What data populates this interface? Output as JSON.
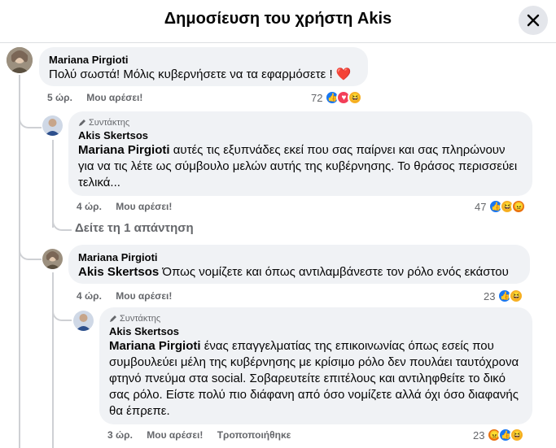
{
  "header": {
    "title": "Δημοσίευση του χρήστη Akis"
  },
  "comments": [
    {
      "author": "Mariana Pirgioti",
      "text": "Πολύ σωστά! Μόλις κυβερνήσετε να τα εφαρμόσετε ! ",
      "heart": "❤️",
      "time": "5 ώρ.",
      "like": "Μου αρέσει!",
      "reactions": "72"
    },
    {
      "badge": "Συντάκτης",
      "author": "Akis Skertsos",
      "mention": "Mariana Pirgioti",
      "text": " αυτές τις εξυπνάδες εκεί που σας παίρνει και σας πληρώνουν για να τις λέτε ως σύμβουλο μελών αυτής της κυβέρνησης. Το θράσος περισσεύει τελικά...",
      "time": "4 ώρ.",
      "like": "Μου αρέσει!",
      "reactions": "47"
    },
    {
      "see_replies": "Δείτε τη 1 απάντηση"
    },
    {
      "author": "Mariana Pirgioti",
      "mention": "Akis Skertsos",
      "text": " Όπως νομίζετε και όπως αντιλαμβάνεστε τον ρόλο ενός εκάστου",
      "time": "4 ώρ.",
      "like": "Μου αρέσει!",
      "reactions": "23"
    },
    {
      "badge": "Συντάκτης",
      "author": "Akis Skertsos",
      "mention": "Mariana Pirgioti",
      "text": " ένας επαγγελματίας της επικοινωνίας όπως εσείς που συμβουλεύει μέλη της κυβέρνησης με κρίσιμο ρόλο δεν πουλάει ταυτόχρονα φτηνό πνεύμα στα social. Σοβαρευτείτε επιτέλους και αντιληφθείτε το δικό σας ρόλο. Είστε πολύ πιο διάφανη από όσο νομίζετε αλλά όχι όσο διαφανής θα έπρεπε.",
      "time": "3 ώρ.",
      "like": "Μου αρέσει!",
      "edited": "Τροποποιήθηκε",
      "reactions": "23"
    }
  ],
  "colors": {
    "like": "#1877f2",
    "love": "#f33e58",
    "haha": "#f7b125",
    "angry": "#e9710f"
  }
}
